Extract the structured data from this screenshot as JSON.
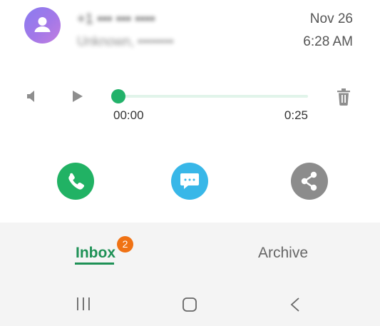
{
  "message": {
    "avatar_icon": "person-icon",
    "contact_name": "+1 ••• ••• ••••",
    "contact_subtitle": "Unknown, ••••••••",
    "date": "Nov 26",
    "time": "6:28 AM"
  },
  "player": {
    "volume_icon": "speaker-icon",
    "play_icon": "play-icon",
    "current_time": "00:00",
    "total_time": "0:25",
    "progress": 0,
    "delete_icon": "trash-icon",
    "accent_color": "#22b26a"
  },
  "actions": [
    {
      "name": "call",
      "icon": "phone-icon",
      "color": "#21b264"
    },
    {
      "name": "message",
      "icon": "chat-bubble-icon",
      "color": "#38b7e8"
    },
    {
      "name": "share",
      "icon": "share-icon",
      "color": "#8c8c8c"
    }
  ],
  "tabs": {
    "inbox_label": "Inbox",
    "inbox_badge": "2",
    "archive_label": "Archive",
    "active": "Inbox",
    "active_color": "#1e9156",
    "badge_color": "#f07214"
  },
  "navbar": {
    "recent_icon": "recent-apps-icon",
    "home_icon": "home-icon",
    "back_icon": "back-icon"
  }
}
